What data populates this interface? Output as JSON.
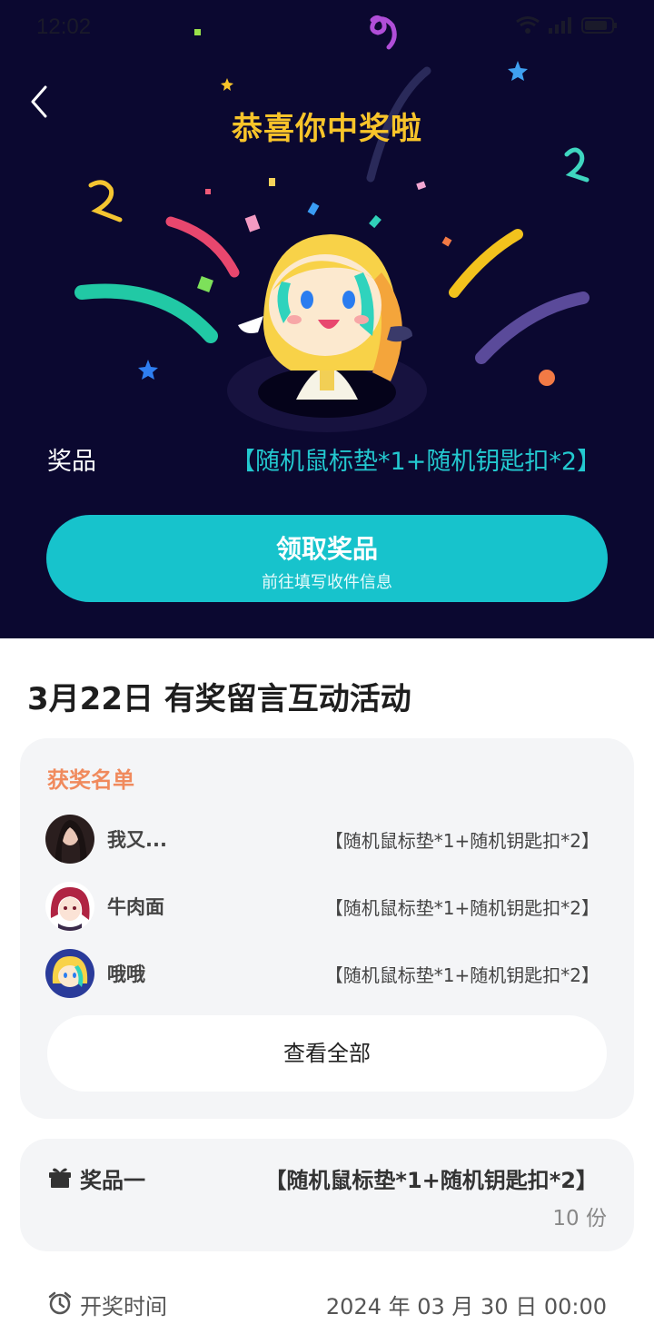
{
  "status_bar": {
    "time": "12:02"
  },
  "hero": {
    "title": "恭喜你中奖啦",
    "prize_label": "奖品",
    "prize_value": "【随机鼠标垫*1+随机钥匙扣*2】",
    "claim_button": {
      "label": "领取奖品",
      "sublabel": "前往填写收件信息"
    }
  },
  "activity": {
    "title": "3月22日 有奖留言互动活动"
  },
  "winners": {
    "heading": "获奖名单",
    "items": [
      {
        "name": "我又...",
        "prize": "【随机鼠标垫*1+随机钥匙扣*2】"
      },
      {
        "name": "牛肉面",
        "prize": "【随机鼠标垫*1+随机钥匙扣*2】"
      },
      {
        "name": "哦哦",
        "prize": "【随机鼠标垫*1+随机钥匙扣*2】"
      }
    ],
    "view_all": "查看全部"
  },
  "prize_info": {
    "label": "奖品一",
    "value": "【随机鼠标垫*1+随机钥匙扣*2】",
    "count": "10 份"
  },
  "draw_time": {
    "label": "开奖时间",
    "value": "2024 年 03 月 30 日 00:00"
  },
  "colors": {
    "hero_bg": "#0b0830",
    "title_gold": "#f8c42a",
    "accent_teal": "#17c3cc",
    "winners_heading": "#f08a5d"
  },
  "icons": [
    "back-arrow-icon",
    "wifi-icon",
    "signal-icon",
    "battery-icon",
    "gift-icon",
    "alarm-clock-icon"
  ]
}
